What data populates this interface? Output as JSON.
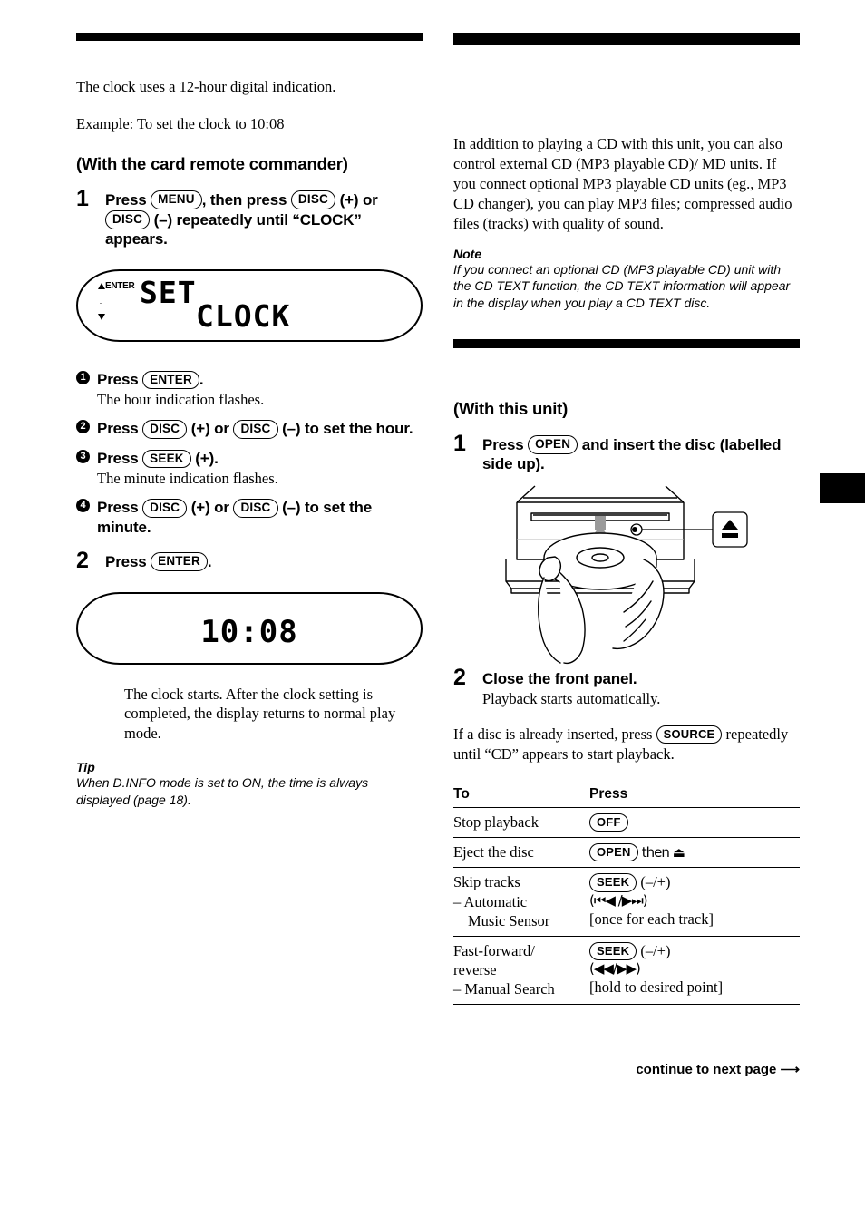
{
  "left_column": {
    "intro_lines": [
      "The clock uses a 12-hour digital indication.",
      "Example: To set the clock to 10:08"
    ],
    "section_heading": "(With the card remote commander)",
    "step1": {
      "number": "1",
      "text_part1": "Press",
      "key_menu": "MENU",
      "text_part2": ", then press",
      "key_disc_plus": "DISC",
      "text_part3": "(+)",
      "text_part4": "or",
      "key_disc_minus": "DISC",
      "text_part5": "(–) repeatedly until “CLOCK” appears."
    },
    "lcd_clock_set": {
      "indicator_enter": "ENTER",
      "indicator_dot": "·",
      "line1": "SET",
      "line2": "CLOCK"
    },
    "substeps": [
      {
        "num": "1",
        "text_part1": "Press",
        "key1": "ENTER",
        "text_part2": ".",
        "note": "The hour indication flashes."
      },
      {
        "num": "2",
        "text_part1": "Press",
        "key1": "DISC",
        "text_part2": "(+) or",
        "key2": "DISC",
        "text_part3": "(–) to set the hour.",
        "note": ""
      },
      {
        "num": "3",
        "text_part1": "Press",
        "key1": "SEEK",
        "text_part2": "(+).",
        "note": "The minute indication flashes."
      },
      {
        "num": "4",
        "text_part1": "Press",
        "key1": "DISC",
        "text_part2": "(+) or",
        "key2": "DISC",
        "text_part3": "(–) to set the minute.",
        "note": ""
      }
    ],
    "step2": {
      "number": "2",
      "text_part1": "Press",
      "key_enter": "ENTER",
      "text_part2": "."
    },
    "lcd_time": {
      "time": "10:08"
    },
    "result_text": "The clock starts. After the clock setting is completed, the display returns to normal play mode.",
    "tip": {
      "label": "Tip",
      "body": "When D.INFO mode is set to ON, the time is always displayed (page 18)."
    }
  },
  "right_column": {
    "intro_paragraph": "In addition to playing a CD with this unit, you can also control external CD (MP3 playable CD)/ MD units. If you connect optional MP3 playable CD units (eg., MP3 CD changer), you can play MP3 files; compressed audio files (tracks) with quality of sound.",
    "note": {
      "label": "Note",
      "body": "If you connect an optional CD (MP3 playable CD) unit with the CD TEXT function, the CD TEXT information will appear in the display when you play a CD TEXT disc."
    },
    "section_heading": "(With this unit)",
    "step1": {
      "number": "1",
      "text_part1": "Press",
      "key_open": "OPEN",
      "text_part2": "and insert the disc (labelled side up)."
    },
    "illustration": {
      "eject_symbol": "▲",
      "alt": "hand inserting disc into front-loading CD slot with eject button callout"
    },
    "step2": {
      "number": "2",
      "text": "Close the front panel.",
      "note": "Playback starts automatically."
    },
    "source_paragraph": {
      "text_part1": "If a disc is already inserted, press",
      "key_source": "SOURCE",
      "text_part2": "repeatedly until “CD” appears to start playback."
    },
    "table": {
      "headers": [
        "To",
        "Press"
      ],
      "rows": [
        {
          "to": [
            "Stop playback"
          ],
          "press_key1": "OFF",
          "press_rest1": "",
          "press_lines": []
        },
        {
          "to": [
            "Eject the disc"
          ],
          "press_key1": "OPEN",
          "press_rest1": "then ⏏",
          "press_lines": []
        },
        {
          "to": [
            "Skip tracks",
            "– Automatic",
            "Music Sensor"
          ],
          "press_key1": "SEEK",
          "press_rest1": "(–/+)",
          "press_lines": [
            "(⏮◀ /▶⏭)",
            "[once for each track]"
          ]
        },
        {
          "to": [
            "Fast-forward/",
            "reverse",
            "– Manual Search"
          ],
          "press_key1": "SEEK",
          "press_rest1": "(–/+)",
          "press_lines": [
            "(◀◀/▶▶)",
            "[hold to desired point]"
          ]
        }
      ]
    },
    "footer": "continue to next page ⟶"
  }
}
